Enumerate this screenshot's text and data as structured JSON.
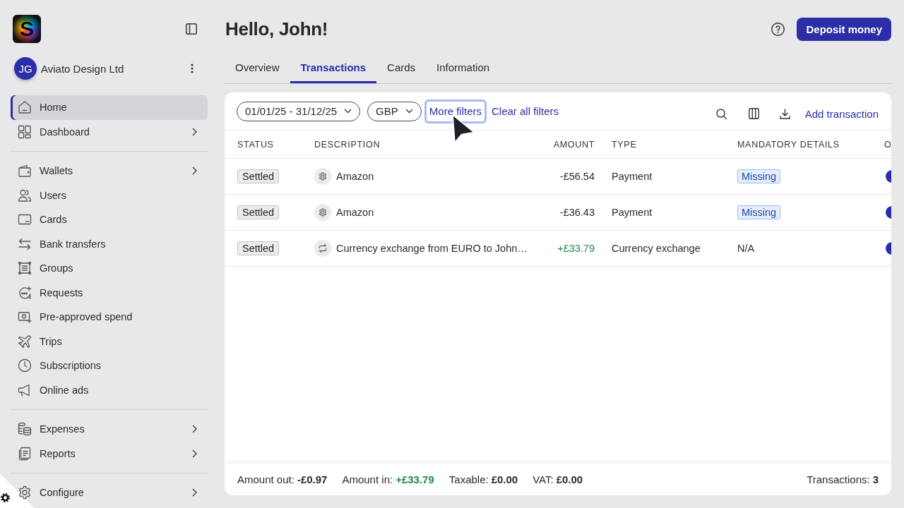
{
  "sidebar": {
    "logo": "S",
    "account": {
      "initials": "JG",
      "name": "Aviato Design Ltd"
    },
    "sections": [
      [
        {
          "label": "Home",
          "selected": true,
          "submenu": false
        },
        {
          "label": "Dashboard",
          "selected": false,
          "submenu": true
        }
      ],
      [
        {
          "label": "Wallets",
          "selected": false,
          "submenu": true
        },
        {
          "label": "Users",
          "selected": false,
          "submenu": false
        },
        {
          "label": "Cards",
          "selected": false,
          "submenu": false
        },
        {
          "label": "Bank transfers",
          "selected": false,
          "submenu": false
        },
        {
          "label": "Groups",
          "selected": false,
          "submenu": false
        },
        {
          "label": "Requests",
          "selected": false,
          "submenu": false
        },
        {
          "label": "Pre-approved spend",
          "selected": false,
          "submenu": false
        },
        {
          "label": "Trips",
          "selected": false,
          "submenu": false
        },
        {
          "label": "Subscriptions",
          "selected": false,
          "submenu": false
        },
        {
          "label": "Online ads",
          "selected": false,
          "submenu": false
        }
      ],
      [
        {
          "label": "Expenses",
          "selected": false,
          "submenu": true
        },
        {
          "label": "Reports",
          "selected": false,
          "submenu": true
        }
      ],
      [
        {
          "label": "Configure",
          "selected": false,
          "submenu": true
        }
      ]
    ]
  },
  "header": {
    "title": "Hello, John!",
    "button": "Deposit money"
  },
  "tabs": [
    {
      "label": "Overview",
      "selected": false
    },
    {
      "label": "Transactions",
      "selected": true
    },
    {
      "label": "Cards",
      "selected": false
    },
    {
      "label": "Information",
      "selected": false
    }
  ],
  "filters": {
    "dropdowns": [
      "01/01/25 - 31/12/25",
      "GBP"
    ],
    "links": [
      {
        "label": "More filters",
        "focused": true
      },
      {
        "label": "Clear all filters",
        "focused": false
      }
    ],
    "action": "Add transaction"
  },
  "table": {
    "columns": [
      "STATUS",
      "DESCRIPTION",
      "AMOUNT",
      "TYPE",
      "MANDATORY DETAILS",
      "O"
    ],
    "rows": [
      {
        "status": "Settled",
        "kind": "payment",
        "description": "Amazon",
        "amount": "-£56.54",
        "positive": false,
        "type": "Payment",
        "details": {
          "text": "Missing",
          "kind": "badge"
        }
      },
      {
        "status": "Settled",
        "kind": "payment",
        "description": "Amazon",
        "amount": "-£36.43",
        "positive": false,
        "type": "Payment",
        "details": {
          "text": "Missing",
          "kind": "badge"
        }
      },
      {
        "status": "Settled",
        "kind": "exchange",
        "description": "Currency exchange from EURO to John…",
        "amount": "+£33.79",
        "positive": true,
        "type": "Currency exchange",
        "details": {
          "text": "N/A",
          "kind": "plain"
        }
      }
    ]
  },
  "summary": {
    "items": [
      {
        "label": "Amount out:",
        "value": "-£0.97",
        "positive": false
      },
      {
        "label": "Amount in:",
        "value": "+£33.79",
        "positive": true
      },
      {
        "label": "Taxable:",
        "value": "£0.00",
        "positive": false
      },
      {
        "label": "VAT:",
        "value": "£0.00",
        "positive": false
      }
    ],
    "count": {
      "label": "Transactions:",
      "value": "3"
    }
  }
}
